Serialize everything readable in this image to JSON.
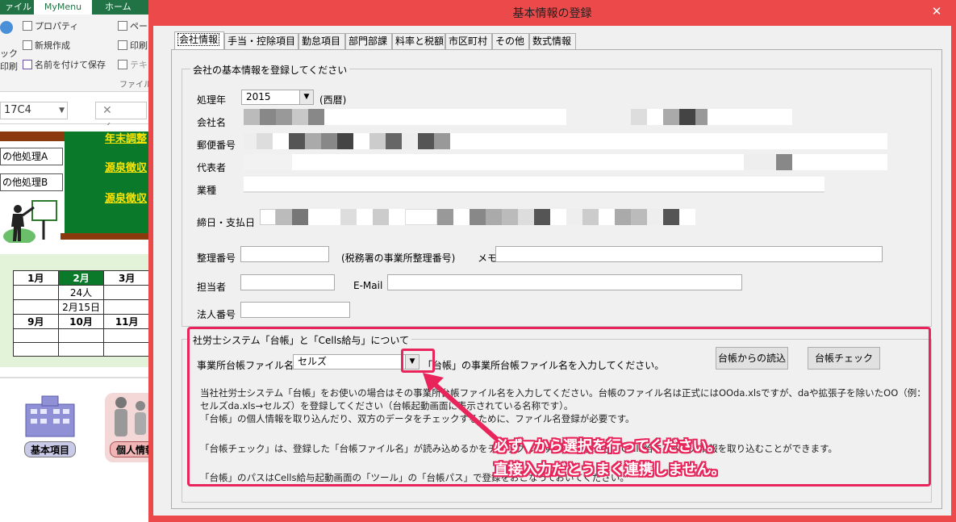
{
  "excel": {
    "ribbon_tabs": [
      "ァイル",
      "MyMenu",
      "ホーム"
    ],
    "active_tab": "MyMenu",
    "ribbon_items": {
      "property": "プロパティ",
      "new": "新規作成",
      "save_as": "名前を付けて保存",
      "check": "ック",
      "print_left": "印刷",
      "page": "ペー",
      "print": "印刷",
      "text": "テキ",
      "group_file": "ファイル"
    },
    "name_box": "17C4",
    "formula_marks": "✕ ✓",
    "menu_buttons": [
      "の他処理A",
      "の他処理B"
    ],
    "green_links": [
      "年末調整",
      "源泉徴収",
      "源泉徴収"
    ],
    "calendar": {
      "months_row1": [
        "1月",
        "2月",
        "3月"
      ],
      "cells_row2": [
        "",
        "24人",
        ""
      ],
      "cells_row3": [
        "",
        "2月15日",
        ""
      ],
      "months_row4": [
        "9月",
        "10月",
        "11月"
      ]
    },
    "bottom_icons": [
      {
        "label": "基本項目"
      },
      {
        "label": "個人情報"
      }
    ]
  },
  "dialog": {
    "title": "基本情報の登録",
    "close_label": "✕",
    "tabs": [
      "会社情報",
      "手当・控除項目",
      "勤怠項目",
      "部門部課",
      "料率と税額",
      "市区町村",
      "その他",
      "数式情報"
    ],
    "active_tab": 0,
    "company_group_legend": "会社の基本情報を登録してください",
    "fields": {
      "year_label": "処理年",
      "year_value": "2015",
      "year_suffix": "(西暦)",
      "company_label": "会社名",
      "zip_label": "郵便番号",
      "rep_label": "代表者",
      "industry_label": "業種",
      "closing_label": "締日・支払日",
      "ref_label": "整理番号",
      "ref_note": "(税務署の事業所整理番号)",
      "memo_label": "メモ",
      "person_label": "担当者",
      "email_label": "E-Mail",
      "corp_label": "法人番号"
    },
    "sr_group": {
      "legend": "社労士システム「台帳」と「Cells給与」について",
      "file_label": "事業所台帳ファイル名",
      "file_value": "セルズ",
      "file_hint": "「台帳」の事業所台帳ファイル名を入力してください。",
      "read_button": "台帳からの読込",
      "check_button": "台帳チェック",
      "para1_line1": "当社社労士システム「台帳」をお使いの場合はその事業所台帳ファイル名を入力してください。台帳のファイル名は正式にはOOda.xlsですが、daや拡張子を除いたOO（例：",
      "para1_line2": "セルズda.xls→セルズ）を登録してください（台帳起動画面に表示されている名称です）。",
      "para1_line3": "「台帳」の個人情報を取り込んだり、双方のデータをチェックするために、ファイル名登録が必要です。",
      "para2": "「台帳チェック」は、登録した「台帳ファイル名」が読み込めるかをチェックします。「台帳」から「Cells給与」へ個人情報を取り込むことができます。",
      "para3": "「台帳」のパスはCells給与起動画面の「ツール」の「台帳パス」で登録をおこなっておいてください。"
    }
  },
  "annotation": {
    "line1": "必ず▼から選択を行ってください。",
    "line2": "直接入力だとうまく連携しません。",
    "color": "#e9245a"
  }
}
